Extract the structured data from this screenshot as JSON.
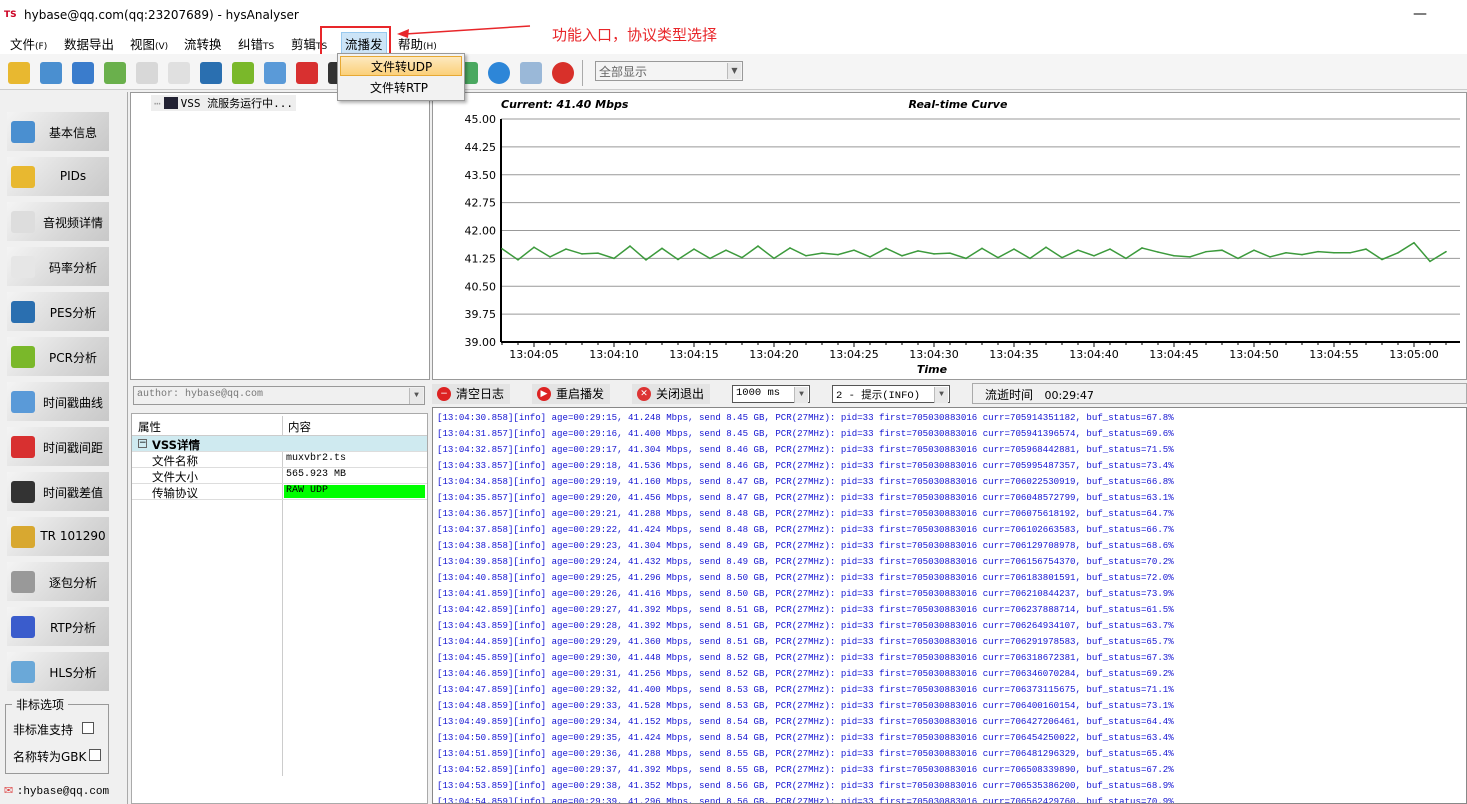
{
  "window": {
    "title": "hybase@qq.com(qq:23207689) - hysAnalyser",
    "icon_text": "TS",
    "minimize": "—"
  },
  "menu": [
    {
      "label": "文件",
      "key": "(F)"
    },
    {
      "label": "数据导出",
      "key": ""
    },
    {
      "label": "视图",
      "key": "(V)"
    },
    {
      "label": "流转换",
      "key": ""
    },
    {
      "label": "纠错",
      "key": "TS"
    },
    {
      "label": "剪辑",
      "key": "TS"
    },
    {
      "label": "流播发",
      "key": ""
    },
    {
      "label": "帮助",
      "key": "(H)"
    }
  ],
  "dropdown": {
    "items": [
      "文件转UDP",
      "文件转RTP"
    ],
    "highlighted": "文件转UDP"
  },
  "annotation": {
    "text": "功能入口，协议类型选择",
    "color": "#e8262a"
  },
  "toolbar": {
    "filter_value": "全部显示",
    "icons": [
      "open-folder-icon",
      "network-icon",
      "info-icon",
      "pie-chart-icon",
      "av-icon",
      "bitrate-icon",
      "pes-icon",
      "pcr-icon",
      "clock-icon",
      "bar-chart-icon",
      "timestamp-diff-icon",
      "export-icon",
      "help-icon",
      "calculator-icon",
      "close-icon"
    ]
  },
  "sidebar": {
    "buttons": [
      {
        "label": "基本信息",
        "icon": "info-icon"
      },
      {
        "label": "PIDs",
        "icon": "pie-chart-icon"
      },
      {
        "label": "音视频详情",
        "icon": "av-icon"
      },
      {
        "label": "码率分析",
        "icon": "bitrate-icon"
      },
      {
        "label": "PES分析",
        "icon": "pes-icon"
      },
      {
        "label": "PCR分析",
        "icon": "pcr-icon"
      },
      {
        "label": "时间戳曲线",
        "icon": "clock-icon"
      },
      {
        "label": "时间戳间距",
        "icon": "bar-chart-icon"
      },
      {
        "label": "时间戳差值",
        "icon": "timestamp-diff-icon"
      },
      {
        "label": "TR 101290",
        "icon": "warning-icon"
      },
      {
        "label": "逐包分析",
        "icon": "binary-icon"
      },
      {
        "label": "RTP分析",
        "icon": "rtp-icon"
      },
      {
        "label": "HLS分析",
        "icon": "network-icon"
      }
    ],
    "options_title": "非标选项",
    "options": [
      {
        "label": "非标准支持",
        "checked": false
      },
      {
        "label": "名称转为GBK",
        "checked": false
      }
    ],
    "contact": ":hybase@qq.com"
  },
  "tree": {
    "node": "VSS 流服务运行中..."
  },
  "author_combo": "author: hybase@qq.com",
  "properties": {
    "headers": [
      "属性",
      "内容"
    ],
    "group": "VSS详情",
    "rows": [
      {
        "name": "文件名称",
        "value": "muxvbr2.ts"
      },
      {
        "name": "文件大小",
        "value": "565.923 MB"
      },
      {
        "name": "传输协议",
        "value": "RAW UDP",
        "highlight": "#00ff00"
      }
    ]
  },
  "logbar": {
    "clear": "清空日志",
    "restart": "重启播发",
    "exit": "关闭退出",
    "interval": "1000 ms",
    "level": "2 - 提示(INFO)",
    "elapsed_label": "流逝时间",
    "elapsed_value": "00:29:47"
  },
  "log": [
    "[13:04:30.858][info] age=00:29:15, 41.248 Mbps, send 8.45 GB, PCR(27MHz): pid=33 first=705030883016 curr=705914351182, buf_status=67.8%",
    "[13:04:31.857][info] age=00:29:16, 41.400 Mbps, send 8.45 GB, PCR(27MHz): pid=33 first=705030883016 curr=705941396574, buf_status=69.6%",
    "[13:04:32.857][info] age=00:29:17, 41.304 Mbps, send 8.46 GB, PCR(27MHz): pid=33 first=705030883016 curr=705968442881, buf_status=71.5%",
    "[13:04:33.857][info] age=00:29:18, 41.536 Mbps, send 8.46 GB, PCR(27MHz): pid=33 first=705030883016 curr=705995487357, buf_status=73.4%",
    "[13:04:34.858][info] age=00:29:19, 41.160 Mbps, send 8.47 GB, PCR(27MHz): pid=33 first=705030883016 curr=706022530919, buf_status=66.8%",
    "[13:04:35.857][info] age=00:29:20, 41.456 Mbps, send 8.47 GB, PCR(27MHz): pid=33 first=705030883016 curr=706048572799, buf_status=63.1%",
    "[13:04:36.857][info] age=00:29:21, 41.288 Mbps, send 8.48 GB, PCR(27MHz): pid=33 first=705030883016 curr=706075618192, buf_status=64.7%",
    "[13:04:37.858][info] age=00:29:22, 41.424 Mbps, send 8.48 GB, PCR(27MHz): pid=33 first=705030883016 curr=706102663583, buf_status=66.7%",
    "[13:04:38.858][info] age=00:29:23, 41.304 Mbps, send 8.49 GB, PCR(27MHz): pid=33 first=705030883016 curr=706129708978, buf_status=68.6%",
    "[13:04:39.858][info] age=00:29:24, 41.432 Mbps, send 8.49 GB, PCR(27MHz): pid=33 first=705030883016 curr=706156754370, buf_status=70.2%",
    "[13:04:40.858][info] age=00:29:25, 41.296 Mbps, send 8.50 GB, PCR(27MHz): pid=33 first=705030883016 curr=706183801591, buf_status=72.0%",
    "[13:04:41.859][info] age=00:29:26, 41.416 Mbps, send 8.50 GB, PCR(27MHz): pid=33 first=705030883016 curr=706210844237, buf_status=73.9%",
    "[13:04:42.859][info] age=00:29:27, 41.392 Mbps, send 8.51 GB, PCR(27MHz): pid=33 first=705030883016 curr=706237888714, buf_status=61.5%",
    "[13:04:43.859][info] age=00:29:28, 41.392 Mbps, send 8.51 GB, PCR(27MHz): pid=33 first=705030883016 curr=706264934107, buf_status=63.7%",
    "[13:04:44.859][info] age=00:29:29, 41.360 Mbps, send 8.51 GB, PCR(27MHz): pid=33 first=705030883016 curr=706291978583, buf_status=65.7%",
    "[13:04:45.859][info] age=00:29:30, 41.448 Mbps, send 8.52 GB, PCR(27MHz): pid=33 first=705030883016 curr=706318672381, buf_status=67.3%",
    "[13:04:46.859][info] age=00:29:31, 41.256 Mbps, send 8.52 GB, PCR(27MHz): pid=33 first=705030883016 curr=706346070284, buf_status=69.2%",
    "[13:04:47.859][info] age=00:29:32, 41.400 Mbps, send 8.53 GB, PCR(27MHz): pid=33 first=705030883016 curr=706373115675, buf_status=71.1%",
    "[13:04:48.859][info] age=00:29:33, 41.528 Mbps, send 8.53 GB, PCR(27MHz): pid=33 first=705030883016 curr=706400160154, buf_status=73.1%",
    "[13:04:49.859][info] age=00:29:34, 41.152 Mbps, send 8.54 GB, PCR(27MHz): pid=33 first=705030883016 curr=706427206461, buf_status=64.4%",
    "[13:04:50.859][info] age=00:29:35, 41.424 Mbps, send 8.54 GB, PCR(27MHz): pid=33 first=705030883016 curr=706454250022, buf_status=63.4%",
    "[13:04:51.859][info] age=00:29:36, 41.288 Mbps, send 8.55 GB, PCR(27MHz): pid=33 first=705030883016 curr=706481296329, buf_status=65.4%",
    "[13:04:52.859][info] age=00:29:37, 41.392 Mbps, send 8.55 GB, PCR(27MHz): pid=33 first=705030883016 curr=706508339890, buf_status=67.2%",
    "[13:04:53.859][info] age=00:29:38, 41.352 Mbps, send 8.56 GB, PCR(27MHz): pid=33 first=705030883016 curr=706535386200, buf_status=68.9%",
    "[13:04:54.859][info] age=00:29:39, 41.296 Mbps, send 8.56 GB, PCR(27MHz): pid=33 first=705030883016 curr=706562429760, buf_status=70.9%"
  ],
  "chart_data": {
    "type": "line",
    "title": "Real-time Curve",
    "current": "Current: 41.40 Mbps",
    "xlabel": "Time",
    "ylabel": "",
    "ylim": [
      39.0,
      45.0
    ],
    "yticks": [
      "45.00",
      "44.25",
      "43.50",
      "42.75",
      "42.00",
      "41.25",
      "40.50",
      "39.75",
      "39.00"
    ],
    "xticks": [
      "13:04:05",
      "13:04:10",
      "13:04:15",
      "13:04:20",
      "13:04:25",
      "13:04:30",
      "13:04:35",
      "13:04:40",
      "13:04:45",
      "13:04:50",
      "13:04:55",
      "13:05:00"
    ],
    "x_start": "13:04:03",
    "x_step_seconds": 1,
    "grid": true,
    "color": "#3c9a3c",
    "values": [
      41.51,
      41.21,
      41.55,
      41.29,
      41.5,
      41.37,
      41.39,
      41.25,
      41.58,
      41.21,
      41.52,
      41.22,
      41.5,
      41.25,
      41.47,
      41.27,
      41.58,
      41.25,
      41.53,
      41.32,
      41.39,
      41.35,
      41.47,
      41.29,
      41.52,
      41.32,
      41.45,
      41.37,
      41.39,
      41.25,
      41.52,
      41.27,
      41.5,
      41.25,
      41.55,
      41.27,
      41.47,
      41.32,
      41.5,
      41.25,
      41.53,
      41.42,
      41.32,
      41.29,
      41.43,
      41.47,
      41.25,
      41.47,
      41.29,
      41.4,
      41.35,
      41.43,
      41.4,
      41.4,
      41.5,
      41.22,
      41.4,
      41.67,
      41.17,
      41.43
    ]
  }
}
